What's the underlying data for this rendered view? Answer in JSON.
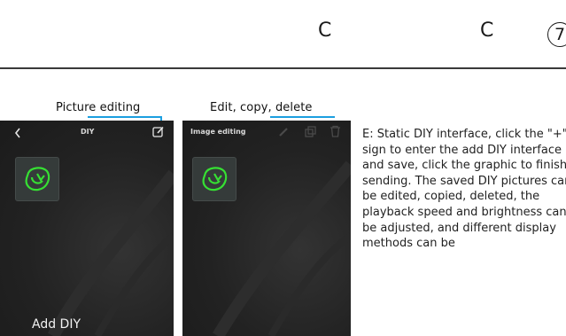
{
  "header": {
    "col_a": "C",
    "col_b": "C",
    "page_number": "7"
  },
  "callouts": {
    "left": "Picture editing",
    "right": "Edit, copy, delete"
  },
  "left_phone": {
    "title": "DIY",
    "back_icon": "chevron-left-icon",
    "edit_icon": "pencil-square-icon",
    "caption": "Add DIY"
  },
  "right_phone": {
    "title": "Image editing",
    "icons": [
      "pencil-icon",
      "copy-icon",
      "trash-icon"
    ]
  },
  "tile_glyph_color": "#36e033",
  "accent_color": "#1c9fe0",
  "description": "E: Static DIY interface, click the \"+\" sign to enter the add DIY interface and save, click the graphic to finish sending. The saved DIY pictures can be edited, copied, deleted, the playback speed and brightness can be adjusted, and different display methods can be"
}
